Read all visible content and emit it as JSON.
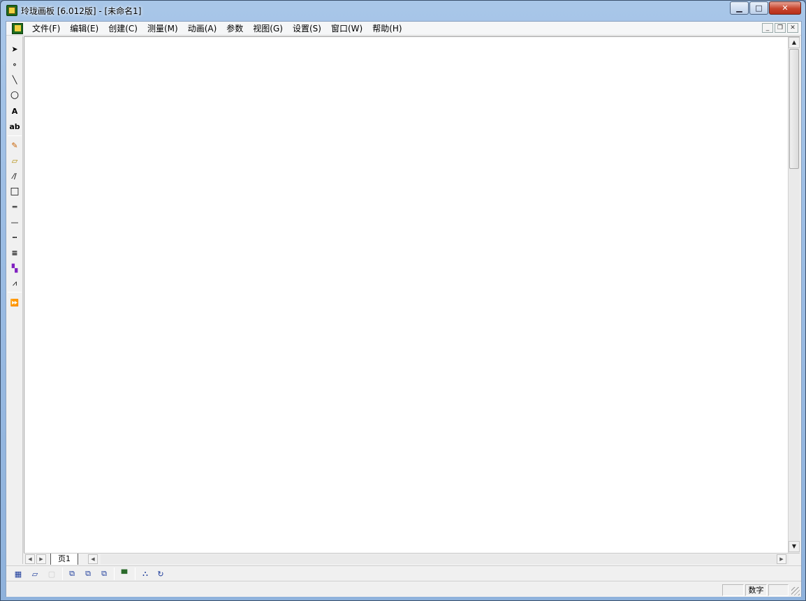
{
  "window": {
    "title": "玲珑画板 [6.012版] - [未命名1]",
    "caption": {
      "minimize": "▁",
      "maximize": "□",
      "close": "✕"
    }
  },
  "menubar": {
    "items": [
      {
        "label": "文件(F)"
      },
      {
        "label": "编辑(E)"
      },
      {
        "label": "创建(C)"
      },
      {
        "label": "测量(M)"
      },
      {
        "label": "动画(A)"
      },
      {
        "label": "参数"
      },
      {
        "label": "视图(G)"
      },
      {
        "label": "设置(S)"
      },
      {
        "label": "窗口(W)"
      },
      {
        "label": "帮助(H)"
      }
    ],
    "mdi": {
      "minimize": "_",
      "restore": "❐",
      "close": "✕"
    }
  },
  "toolbox": {
    "tools": [
      {
        "name": "select-arrow-icon",
        "glyph": "➤"
      },
      {
        "name": "point-tool-icon",
        "glyph": "∘"
      },
      {
        "name": "line-tool-icon",
        "glyph": "╲"
      },
      {
        "name": "circle-tool-icon",
        "glyph": "○"
      },
      {
        "name": "text-tool-icon",
        "glyph": "A"
      },
      {
        "name": "label-tool-icon",
        "glyph": "ab"
      },
      {
        "name": "pencil-tool-icon",
        "glyph": "✎"
      },
      {
        "name": "eraser-tool-icon",
        "glyph": "▱"
      },
      {
        "name": "polyline-tool-icon",
        "glyph": "⁄∕"
      },
      {
        "name": "rectangle-tool-icon",
        "glyph": "□"
      },
      {
        "name": "thick-line-icon",
        "glyph": "═"
      },
      {
        "name": "thin-line-icon",
        "glyph": "—"
      },
      {
        "name": "dotted-line-icon",
        "glyph": "┅"
      },
      {
        "name": "multi-line-icon",
        "glyph": "≡"
      },
      {
        "name": "color-palette-icon",
        "glyph": "▚"
      },
      {
        "name": "function-graph-icon",
        "glyph": "⩘"
      },
      {
        "name": "fast-forward-icon",
        "glyph": "⏩"
      }
    ]
  },
  "page_tabs": {
    "current": "页1"
  },
  "status": {
    "num_indicator": "数字"
  }
}
